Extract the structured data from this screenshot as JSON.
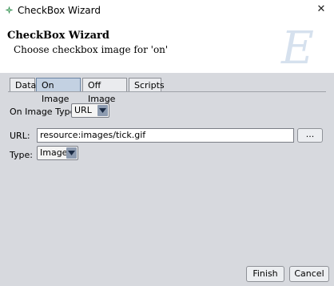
{
  "window": {
    "title": "CheckBox Wizard",
    "close_glyph": "✕"
  },
  "header": {
    "title": "CheckBox Wizard",
    "subtitle": "Choose checkbox image for 'on'",
    "watermark_letter": "E"
  },
  "tabs": [
    {
      "label": "Data",
      "active": false
    },
    {
      "label": "On Image",
      "active": true
    },
    {
      "label": "Off Image",
      "active": false
    },
    {
      "label": "Scripts",
      "active": false
    }
  ],
  "form": {
    "on_image_type_label": "On Image Type:",
    "on_image_type_value": "URL",
    "url_label": "URL:",
    "url_value": "resource:images/tick.gif",
    "browse_label": "...",
    "type_label": "Type:",
    "type_value": "Image"
  },
  "buttons": {
    "finish": "Finish",
    "cancel": "Cancel"
  },
  "icons": {
    "app": "wizard-app-icon",
    "close": "close-icon",
    "dropdown": "chevron-down-icon",
    "watermark": "script-e-watermark-icon"
  },
  "colors": {
    "content_bg": "#d7d9de",
    "active_tab": "#c3d1e2",
    "dropdown_arrow_bg": "#8d9bb0",
    "watermark": "#d6e1ee"
  }
}
